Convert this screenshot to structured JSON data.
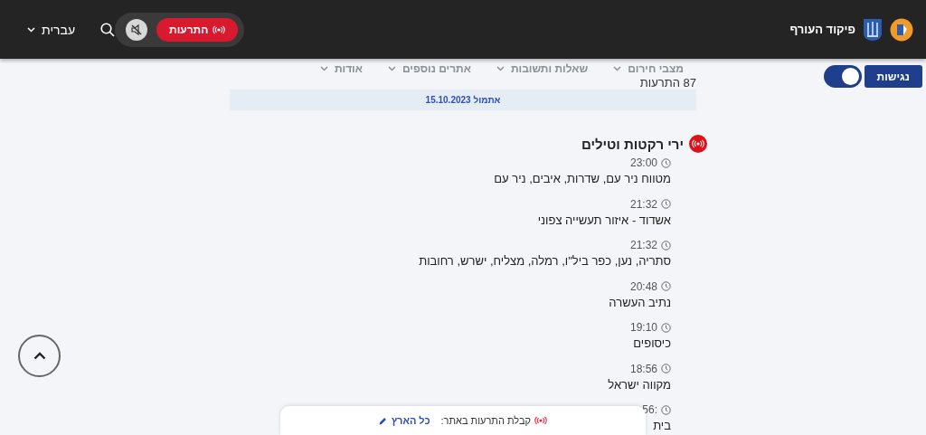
{
  "header": {
    "brand": "פיקוד העורף",
    "alerts_button": "התרעות",
    "sound_muted": true,
    "language": "עברית"
  },
  "nav": [
    "מצבי חירום",
    "שאלות ותשובות",
    "אתרים נוספים",
    "אודות"
  ],
  "accessibility": {
    "label": "נגישות",
    "on": true
  },
  "alert_count": "87 התרעות",
  "date_banner": "אתמול 15.10.2023",
  "category": {
    "title": "ירי רקטות וטילים",
    "entries": [
      {
        "time": "23:00",
        "places": "מטווח ניר עם, שדרות, איבים, ניר עם"
      },
      {
        "time": "21:32",
        "places": "אשדוד - איזור תעשייה צפוני"
      },
      {
        "time": "21:32",
        "places": "סתריה, נען, כפר ביל\"ו, רמלה, מצליח, ישרש, רחובות"
      },
      {
        "time": "20:48",
        "places": "נתיב העשרה"
      },
      {
        "time": "19:10",
        "places": "כיסופים"
      },
      {
        "time": "18:56",
        "places": "מקווה ישראל"
      },
      {
        "time": ":56",
        "places": "בית"
      }
    ]
  },
  "bottom_bar": {
    "label": "קבלת התרעות באתר:",
    "area": "כל הארץ"
  }
}
